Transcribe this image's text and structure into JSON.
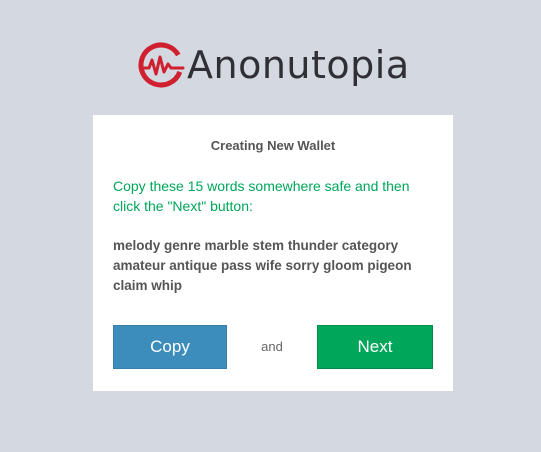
{
  "brand": {
    "name": "Anonutopia",
    "accent_color": "#d0202f",
    "logo_icon": "anonutopia-logo-icon"
  },
  "wallet": {
    "title": "Creating New Wallet",
    "instruction": "Copy these 15 words somewhere safe and then click the \"Next\" button:",
    "seed_phrase": "melody genre marble stem thunder category amateur antique pass wife sorry gloom pigeon claim whip"
  },
  "actions": {
    "copy_label": "Copy",
    "and_label": "and",
    "next_label": "Next",
    "copy_color": "#3c8dbc",
    "next_color": "#00a65a"
  }
}
